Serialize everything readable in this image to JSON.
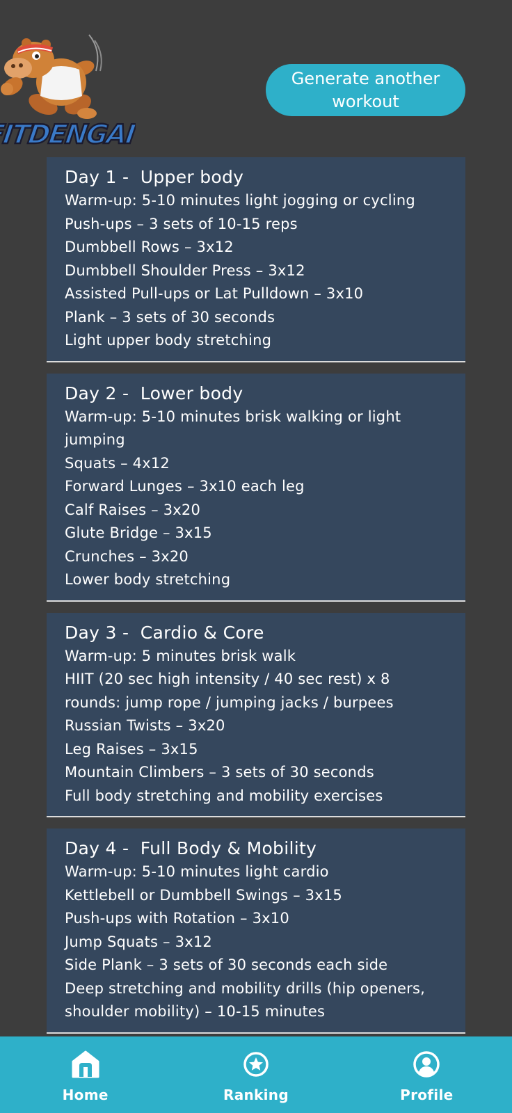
{
  "app": {
    "logo_text": "FITDENGAI"
  },
  "header": {
    "generate_button_label": "Generate another workout"
  },
  "days": [
    {
      "day": "Day 1",
      "sep": " -  ",
      "title": "Upper body",
      "items": [
        "Warm-up: 5-10 minutes light jogging or cycling",
        "Push-ups – 3 sets of 10-15 reps",
        "Dumbbell Rows – 3x12",
        "Dumbbell Shoulder Press – 3x12",
        "Assisted Pull-ups or Lat Pulldown – 3x10",
        "Plank – 3 sets of 30 seconds",
        "Light upper body stretching"
      ]
    },
    {
      "day": "Day 2",
      "sep": " -  ",
      "title": "Lower body",
      "items": [
        "Warm-up: 5-10 minutes brisk walking or light jumping",
        "Squats – 4x12",
        "Forward Lunges – 3x10 each leg",
        "Calf Raises – 3x20",
        "Glute Bridge – 3x15",
        "Crunches – 3x20",
        "Lower body stretching"
      ]
    },
    {
      "day": "Day 3",
      "sep": " -  ",
      "title": "Cardio & Core",
      "items": [
        "Warm-up: 5 minutes brisk walk",
        "HIIT (20 sec high intensity / 40 sec rest) x 8 rounds: jump rope / jumping jacks / burpees",
        "Russian Twists – 3x20",
        "Leg Raises – 3x15",
        "Mountain Climbers – 3 sets of 30 seconds",
        "Full body stretching and mobility exercises"
      ]
    },
    {
      "day": "Day 4",
      "sep": " -  ",
      "title": "Full Body & Mobility",
      "items": [
        "Warm-up: 5-10 minutes light cardio",
        "Kettlebell or Dumbbell Swings – 3x15",
        "Push-ups with Rotation – 3x10",
        "Jump Squats – 3x12",
        "Side Plank – 3 sets of 30 seconds each side",
        "Deep stretching and mobility drills (hip openers, shoulder mobility) – 10-15 minutes"
      ]
    }
  ],
  "nav": {
    "items": [
      {
        "label": "Home",
        "icon": "home-icon"
      },
      {
        "label": "Ranking",
        "icon": "star-circle-icon"
      },
      {
        "label": "Profile",
        "icon": "profile-icon"
      }
    ]
  },
  "colors": {
    "background": "#3d3d3d",
    "card": "#35475d",
    "accent": "#2eb0c9"
  }
}
